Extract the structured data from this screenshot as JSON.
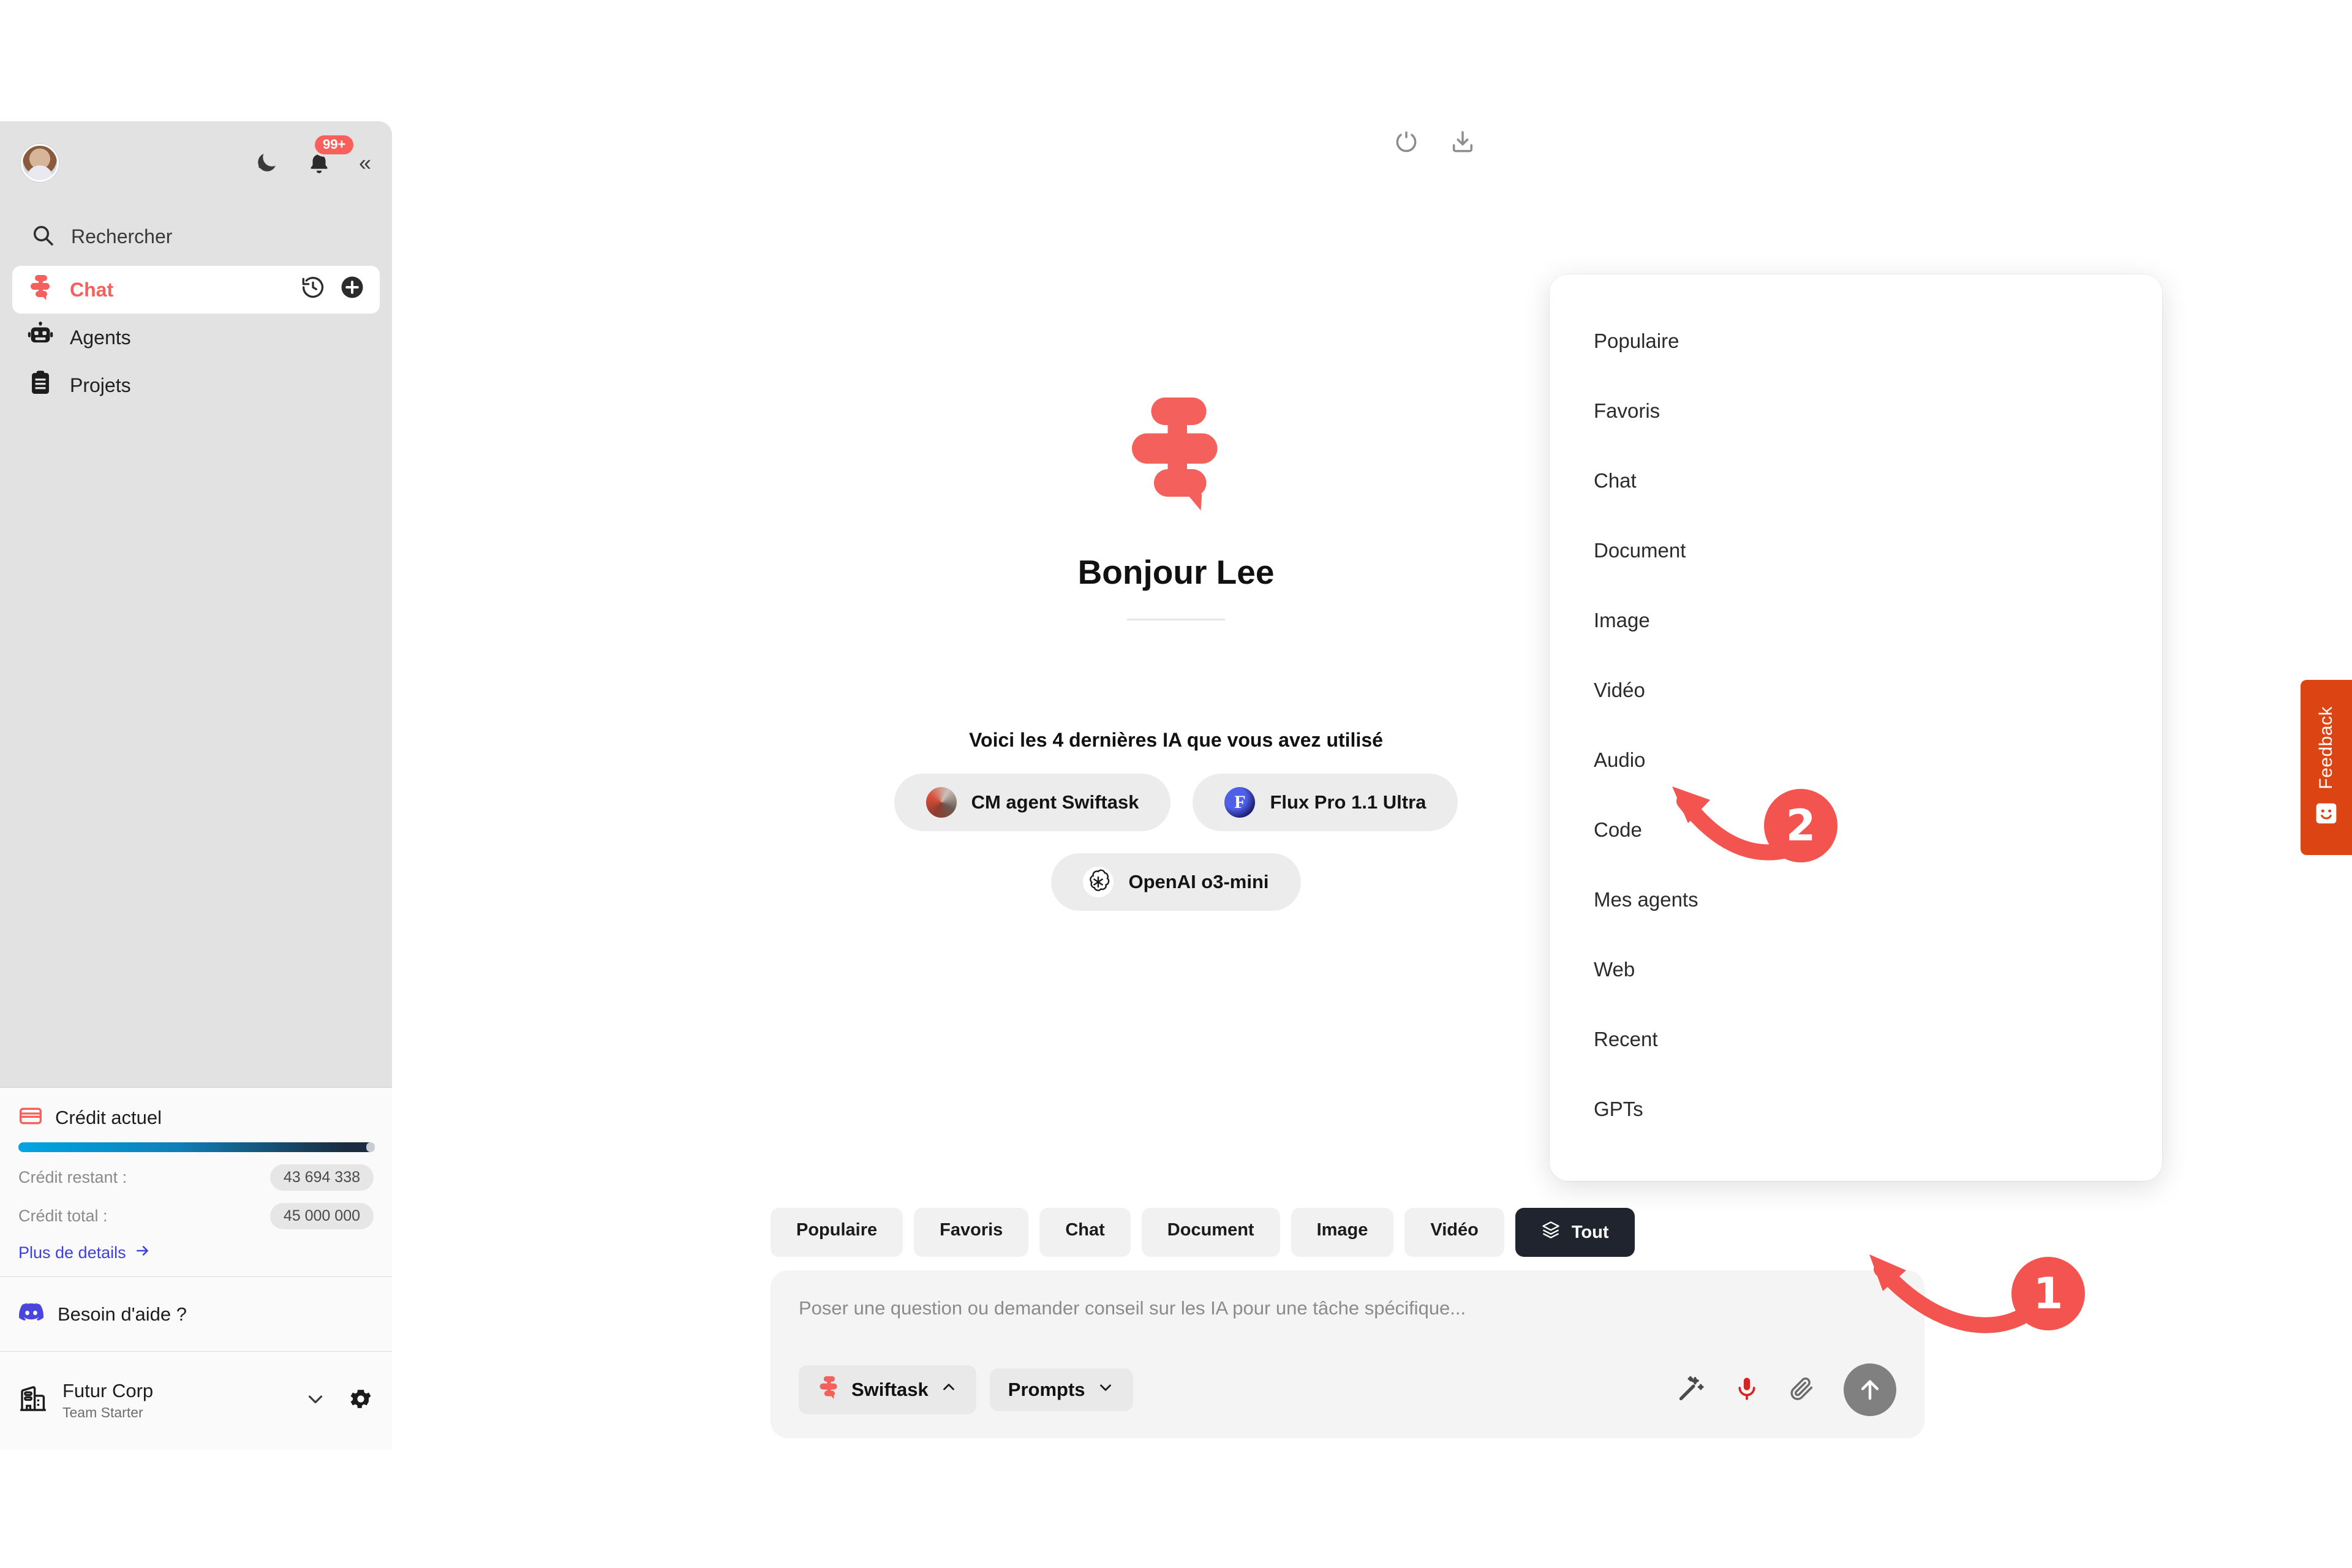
{
  "app": {
    "brand": "Swiftask",
    "accent": "#f4605c",
    "annotation_color": "#f4544f"
  },
  "sidebar": {
    "notification_badge": "99+",
    "search": {
      "label": "Rechercher",
      "icon": "search-icon"
    },
    "nav": [
      {
        "label": "Chat",
        "icon": "swiftask-logo-icon",
        "active": true
      },
      {
        "label": "Agents",
        "icon": "robot-icon",
        "active": false
      },
      {
        "label": "Projets",
        "icon": "clipboard-icon",
        "active": false
      }
    ],
    "credit": {
      "title": "Crédit actuel",
      "icon": "credit-card-icon",
      "remaining_label": "Crédit restant :",
      "remaining_value": "43 694 338",
      "total_label": "Crédit total :",
      "total_value": "45 000 000",
      "more_details": "Plus de details",
      "progress_percent": 97
    },
    "help": {
      "label": "Besoin d'aide ?",
      "icon": "discord-icon"
    },
    "org": {
      "name": "Futur Corp",
      "plan": "Team Starter",
      "icon": "building-icon"
    }
  },
  "topbar": {
    "refresh_icon": "refresh-icon",
    "download_icon": "download-icon"
  },
  "hero": {
    "logo_icon": "swiftask-logo-icon",
    "greeting": "Bonjour Lee"
  },
  "recent": {
    "title": "Voici les 4 dernières IA que vous avez utilisé",
    "chips": [
      {
        "label": "CM agent Swiftask",
        "icon": "cm-agent-avatar-icon"
      },
      {
        "label": "Flux Pro 1.1 Ultra",
        "icon": "flux-logo-icon"
      },
      {
        "label": "OpenAI o3-mini",
        "icon": "openai-logo-icon"
      }
    ]
  },
  "dropdown": {
    "items": [
      "Populaire",
      "Favoris",
      "Chat",
      "Document",
      "Image",
      "Vidéo",
      "Audio",
      "Code",
      "Mes agents",
      "Web",
      "Recent",
      "GPTs"
    ]
  },
  "composer": {
    "filters": [
      {
        "label": "Populaire",
        "selected": false
      },
      {
        "label": "Favoris",
        "selected": false
      },
      {
        "label": "Chat",
        "selected": false
      },
      {
        "label": "Document",
        "selected": false
      },
      {
        "label": "Image",
        "selected": false
      },
      {
        "label": "Vidéo",
        "selected": false
      },
      {
        "label": "Tout",
        "selected": true,
        "icon": "layers-icon"
      }
    ],
    "input_placeholder": "Poser une question ou demander conseil sur les IA pour une tâche spécifique...",
    "model_button": "Swiftask",
    "prompts_button": "Prompts",
    "tools": [
      {
        "name": "magic-wand-icon"
      },
      {
        "name": "microphone-icon"
      },
      {
        "name": "paperclip-icon"
      },
      {
        "name": "send-icon"
      }
    ]
  },
  "annotations": [
    {
      "number": "1",
      "target": "tout-filter-tab"
    },
    {
      "number": "2",
      "target": "dropdown-item-audio"
    }
  ],
  "feedback": {
    "label": "Feedback",
    "icon": "smiley-icon"
  }
}
